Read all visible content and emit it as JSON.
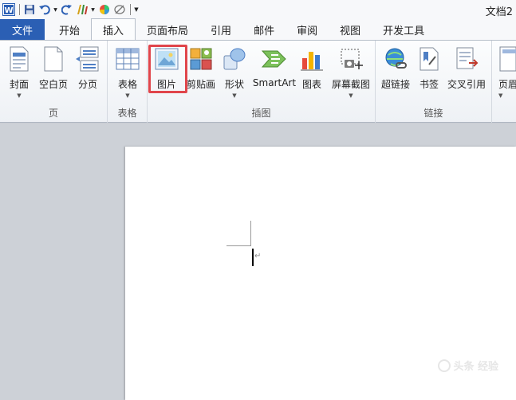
{
  "window": {
    "title": "文档2"
  },
  "qat": {
    "items": [
      {
        "name": "word-logo-icon"
      },
      {
        "name": "save-icon"
      },
      {
        "name": "undo-icon"
      },
      {
        "name": "redo-icon"
      },
      {
        "name": "format-painter-icon"
      },
      {
        "name": "color-icon"
      },
      {
        "name": "clear-format-icon"
      },
      {
        "name": "customize-qat-icon"
      }
    ]
  },
  "tabs": [
    {
      "label": "文件",
      "kind": "file"
    },
    {
      "label": "开始"
    },
    {
      "label": "插入",
      "active": true
    },
    {
      "label": "页面布局"
    },
    {
      "label": "引用"
    },
    {
      "label": "邮件"
    },
    {
      "label": "审阅"
    },
    {
      "label": "视图"
    },
    {
      "label": "开发工具"
    }
  ],
  "ribbon": {
    "groups": {
      "pages": {
        "label": "页",
        "cover": "封面",
        "blank": "空白页",
        "break": "分页"
      },
      "tables": {
        "label": "表格",
        "table": "表格"
      },
      "illustrations": {
        "label": "插图",
        "picture": "图片",
        "clipart": "剪贴画",
        "shapes": "形状",
        "smartart": "SmartArt",
        "chart": "图表",
        "screenshot": "屏幕截图"
      },
      "links": {
        "label": "链接",
        "hyperlink": "超链接",
        "bookmark": "书签",
        "crossref": "交叉引用"
      },
      "header": {
        "label": "页眉"
      }
    },
    "highlighted": "图片"
  },
  "colors": {
    "file_tab": "#2b5fb4",
    "highlight": "#e0454b"
  },
  "watermark": {
    "text": "头条 经验"
  }
}
